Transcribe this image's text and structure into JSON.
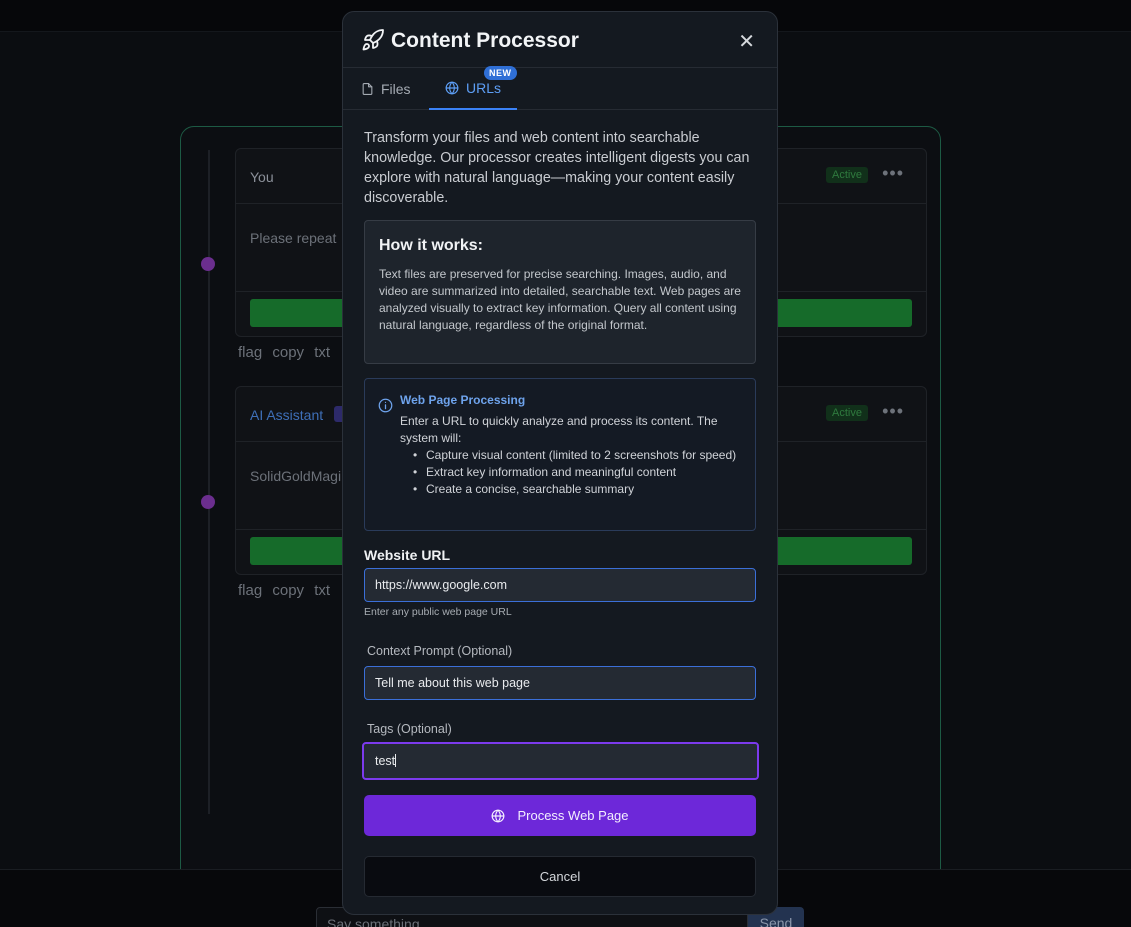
{
  "background": {
    "chat": {
      "messages": [
        {
          "author": "You",
          "status": "Active",
          "text": "Please repeat",
          "actions": "flag copy txt"
        },
        {
          "author": "AI Assistant",
          "status": "Active",
          "text": "SolidGoldMagi",
          "actions": "flag copy txt"
        }
      ],
      "more_label": "•••"
    },
    "composer": {
      "placeholder": "Say something...",
      "send_label": "Send"
    }
  },
  "modal": {
    "title": "Content Processor",
    "close_glyph": "✕",
    "tabs": [
      {
        "label": "Files",
        "icon": "file-icon",
        "active": false
      },
      {
        "label": "URLs",
        "icon": "globe-icon",
        "active": true,
        "badge": "NEW"
      }
    ],
    "intro": "Transform your files and web content into searchable knowledge. Our processor creates intelligent digests you can explore with natural language—making your content easily discoverable.",
    "how_it_works": {
      "title": "How it works:",
      "text": "Text files are preserved for precise searching. Images, audio, and video are summarized into detailed, searchable text. Web pages are analyzed visually to extract key information. Query all content using natural language, regardless of the original format."
    },
    "web_processing": {
      "title": "Web Page Processing",
      "text": "Enter a URL to quickly analyze and process its content. The system will:",
      "items": [
        "Capture visual content (limited to 2 screenshots for speed)",
        "Extract key information and meaningful content",
        "Create a concise, searchable summary"
      ]
    },
    "url_field": {
      "label": "Website URL",
      "value": "https://www.google.com",
      "hint": "Enter any public web page URL"
    },
    "context_field": {
      "label": "Context Prompt (Optional)",
      "value": "Tell me about this web page"
    },
    "tags_field": {
      "label": "Tags (Optional)",
      "value": "test"
    },
    "process_button": "Process Web Page",
    "cancel_button": "Cancel"
  },
  "colors": {
    "accent_purple": "#6d28d9",
    "accent_blue": "#3b82f6",
    "active_green": "#166b2a"
  }
}
